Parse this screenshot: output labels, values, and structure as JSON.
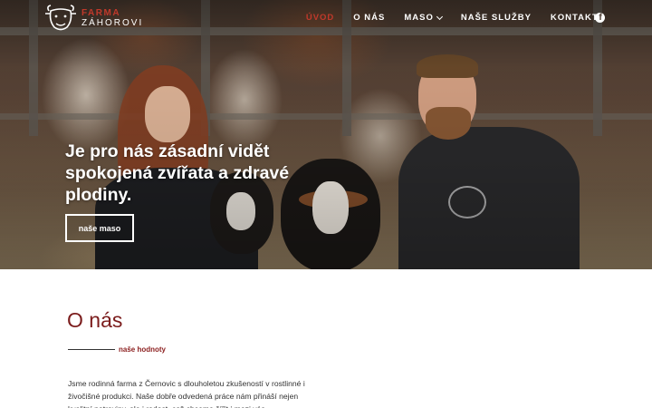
{
  "logo": {
    "line1": "FARMA",
    "line2": "ZÁHOROVI",
    "icon": "cow-head-logo"
  },
  "nav": {
    "items": [
      {
        "label": "ÚVOD",
        "active": true
      },
      {
        "label": "O NÁS",
        "active": false
      },
      {
        "label": "MASO",
        "active": false,
        "dropdown": true
      },
      {
        "label": "NAŠE SLUŽBY",
        "active": false
      },
      {
        "label": "KONTAKTY",
        "active": false
      }
    ],
    "social_icon": "facebook-icon"
  },
  "hero": {
    "title": "Je pro nás zásadní vidět spokojená zvířata a zdravé plodiny.",
    "button_label": "naše maso"
  },
  "about": {
    "title": "O nás",
    "subtitle": "naše hodnoty",
    "text": "Jsme rodinná farma z Černovic s dlouholetou zkušeností v rostlinné i živočišné produkci. Naše dobře odvedená práce nám přináší nejen kvalitní potraviny, ale i radost, což chceme šířit i mezi vás."
  },
  "colors": {
    "accent": "#c0392b",
    "heading": "#7b1c1c",
    "text": "#333333"
  }
}
